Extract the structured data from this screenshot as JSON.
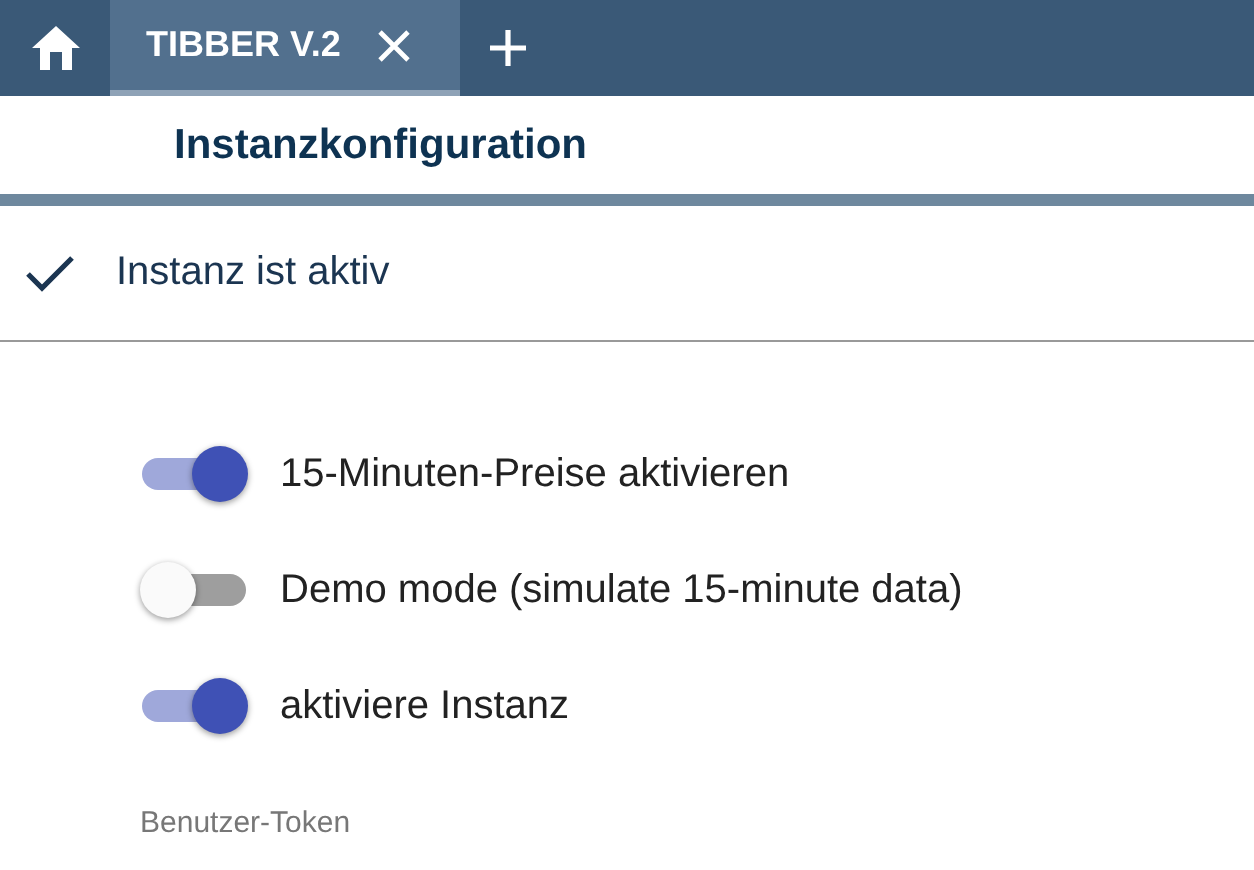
{
  "tabs": [
    {
      "label": "TIBBER V.2",
      "selected": true
    }
  ],
  "title": "Instanzkonfiguration",
  "instance": {
    "label": "Instanz ist aktiv",
    "checked": true
  },
  "settings": [
    {
      "label": "15-Minuten-Preise aktivieren",
      "on": true
    },
    {
      "label": "Demo mode (simulate 15-minute data)",
      "on": false
    },
    {
      "label": "aktiviere Instanz",
      "on": true
    }
  ],
  "token": {
    "label": "Benutzer-Token"
  }
}
